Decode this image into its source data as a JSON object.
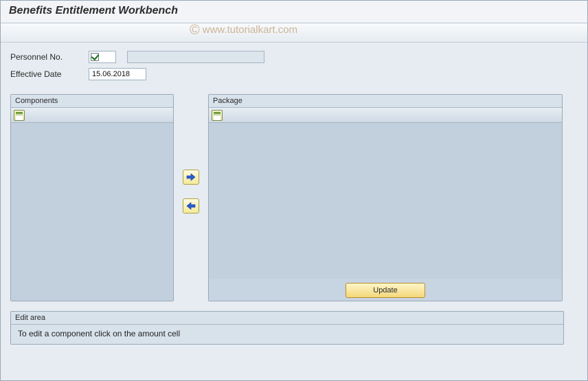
{
  "title": "Benefits Entitlement Workbench",
  "watermark": "www.tutorialkart.com",
  "form": {
    "personnel_label": "Personnel No.",
    "personnel_checked": true,
    "personnel_display": "",
    "effective_date_label": "Effective Date",
    "effective_date_value": "15.06.2018"
  },
  "panels": {
    "components_title": "Components",
    "package_title": "Package"
  },
  "buttons": {
    "move_right_title": "Add",
    "move_left_title": "Remove",
    "update_label": "Update"
  },
  "edit_area": {
    "title": "Edit area",
    "hint": "To edit a component click on the amount cell"
  },
  "icons": {
    "spreadsheet": "spreadsheet-icon",
    "arrow_right": "arrow-right-icon",
    "arrow_left": "arrow-left-icon"
  }
}
